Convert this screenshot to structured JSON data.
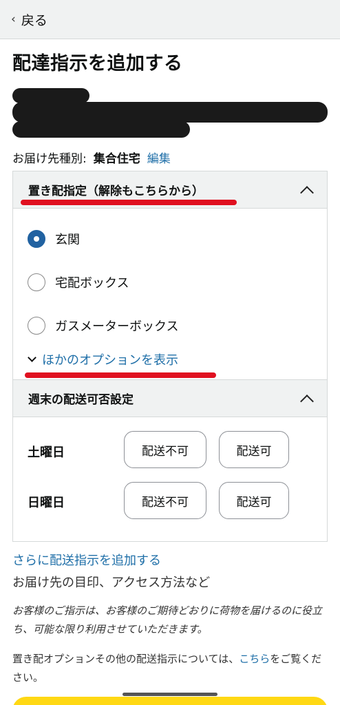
{
  "nav": {
    "back_label": "戻る"
  },
  "page": {
    "title": "配達指示を追加する"
  },
  "address": {
    "type_label": "お届け先種別:",
    "type_value": "集合住宅",
    "edit_label": "編集"
  },
  "dropoff": {
    "title": "置き配指定（解除もこちらから）",
    "options": [
      {
        "label": "玄関",
        "checked": true
      },
      {
        "label": "宅配ボックス",
        "checked": false
      },
      {
        "label": "ガスメーターボックス",
        "checked": false
      }
    ],
    "more_options": "ほかのオプションを表示"
  },
  "weekend": {
    "title": "週末の配送可否設定",
    "days": [
      {
        "label": "土曜日",
        "no_label": "配送不可",
        "yes_label": "配送可"
      },
      {
        "label": "日曜日",
        "no_label": "配送不可",
        "yes_label": "配送可"
      }
    ]
  },
  "additional": {
    "link": "さらに配送指示を追加する",
    "sub": "お届け先の目印、アクセス方法など"
  },
  "notes": {
    "italic": "お客様のご指示は、お客様のご期待どおりに荷物を届けるのに役立ち、可能な限り利用させていただきます。",
    "info_prefix": "置き配オプションその他の配送指示については、",
    "info_link": "こちら",
    "info_suffix": "をご覧ください。"
  },
  "colors": {
    "accent_link": "#1f6fa8",
    "radio_checked": "#2162a1",
    "annotation_red": "#e01020",
    "cta_yellow": "#ffd814"
  }
}
